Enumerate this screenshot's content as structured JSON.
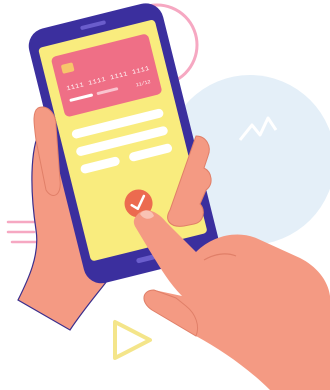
{
  "illustration": {
    "card": {
      "number": "1111 1111 1111 1111",
      "expiry": "11/12"
    },
    "colors": {
      "skin": "#f49a83",
      "skin_dark": "#e07f68",
      "skin_outline": "#3a2e8c",
      "phone_body": "#3b2f9e",
      "screen": "#f9ec7e",
      "card": "#ef6f86",
      "card_chip": "#f7c66b",
      "confirm_button": "#ec6b4f",
      "accent_pink": "#f6a8c2",
      "accent_blue": "#e4eff8",
      "accent_yellow": "#f4e58a"
    },
    "icons": [
      "check-icon",
      "triangle-shape",
      "circle-outline-shape",
      "zigzag-shape"
    ]
  }
}
